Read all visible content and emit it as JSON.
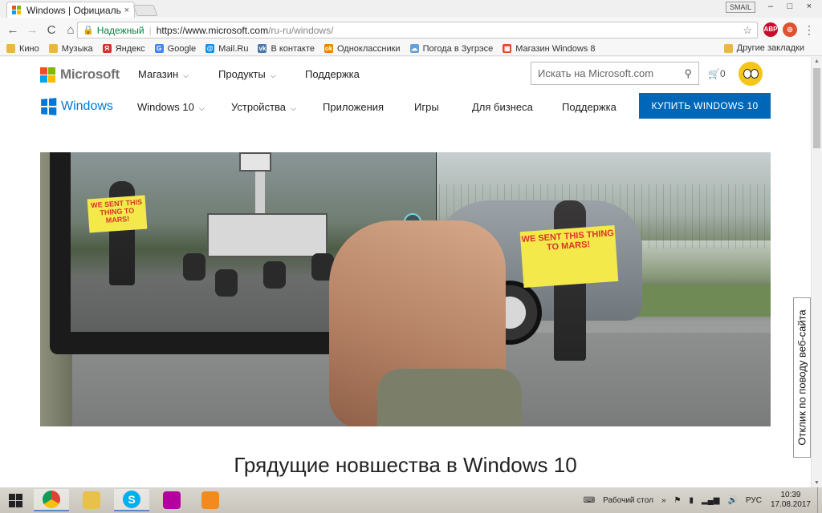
{
  "browser": {
    "tab_title": "Windows | Официальны",
    "tab_close": "×",
    "profile_label": "SMAIL",
    "window_buttons": [
      "–",
      "□",
      "×"
    ],
    "nav": {
      "back": "←",
      "forward": "→",
      "reload": "C",
      "home": "⌂"
    },
    "secure_label": "Надежный",
    "url_host": "https://www.microsoft.com",
    "url_path": "/ru-ru/windows/",
    "star": "☆",
    "extensions": [
      {
        "label": "ABP",
        "color": "#c70d2c"
      },
      {
        "label": "◎",
        "color": "#e0522f"
      }
    ],
    "menu": "⋮"
  },
  "bookmarks": {
    "items": [
      {
        "label": "Кино",
        "icon": "folder-icon",
        "color": "#e8b840"
      },
      {
        "label": "Музыка",
        "icon": "folder-icon",
        "color": "#e8b840"
      },
      {
        "label": "Яндекс",
        "icon": "yandex-icon",
        "color": "#d2322d"
      },
      {
        "label": "Google",
        "icon": "google-icon",
        "color": "#4285f4"
      },
      {
        "label": "Mail.Ru",
        "icon": "mailru-icon",
        "color": "#168de2"
      },
      {
        "label": "В контакте",
        "icon": "vk-icon",
        "color": "#4a76a8"
      },
      {
        "label": "Одноклассники",
        "icon": "ok-icon",
        "color": "#ee8208"
      },
      {
        "label": "Погода в Зугрэсе",
        "icon": "weather-icon",
        "color": "#6aa0d8"
      },
      {
        "label": "Магазин Windows 8",
        "icon": "windows-store-icon",
        "color": "#e04a2a"
      }
    ],
    "other": "Другие закладки"
  },
  "ms_header": {
    "brand": "Microsoft",
    "nav": [
      {
        "label": "Магазин",
        "dropdown": true
      },
      {
        "label": "Продукты",
        "dropdown": true
      },
      {
        "label": "Поддержка",
        "dropdown": false
      }
    ],
    "search_placeholder": "Искать на Microsoft.com",
    "cart_count": "0"
  },
  "windows_nav": {
    "brand": "Windows",
    "items": [
      {
        "label": "Windows 10",
        "dropdown": true
      },
      {
        "label": "Устройства",
        "dropdown": true
      },
      {
        "label": "Приложения",
        "dropdown": false
      },
      {
        "label": "Игры",
        "dropdown": false
      },
      {
        "label": "Для бизнеса",
        "dropdown": false
      },
      {
        "label": "Поддержка",
        "dropdown": false
      }
    ],
    "buy_button": "КУПИТЬ WINDOWS 10"
  },
  "hero": {
    "sign_text": "WE SENT THIS THING TO MARS!",
    "title": "Грядущие новшества в Windows 10"
  },
  "feedback": "Отклик по поводу веб-сайта",
  "taskbar": {
    "apps": [
      {
        "name": "chrome",
        "color": "#4285f4",
        "active": true
      },
      {
        "name": "file-explorer",
        "color": "#e8c14a",
        "active": false
      },
      {
        "name": "skype",
        "color": "#00aff0",
        "active": true
      },
      {
        "name": "camera",
        "color": "#b4009e",
        "active": false
      },
      {
        "name": "media-player",
        "color": "#f28b1f",
        "active": false
      }
    ],
    "desktop_label": "Рабочий стол",
    "language": "РУС",
    "time": "10:39",
    "date": "17.08.2017"
  },
  "colors": {
    "ms_red": "#f25022",
    "ms_green": "#7fba00",
    "ms_blue": "#00a4ef",
    "ms_yellow": "#ffb900",
    "windows_blue": "#0078d7",
    "buy_button": "#0067b8"
  }
}
